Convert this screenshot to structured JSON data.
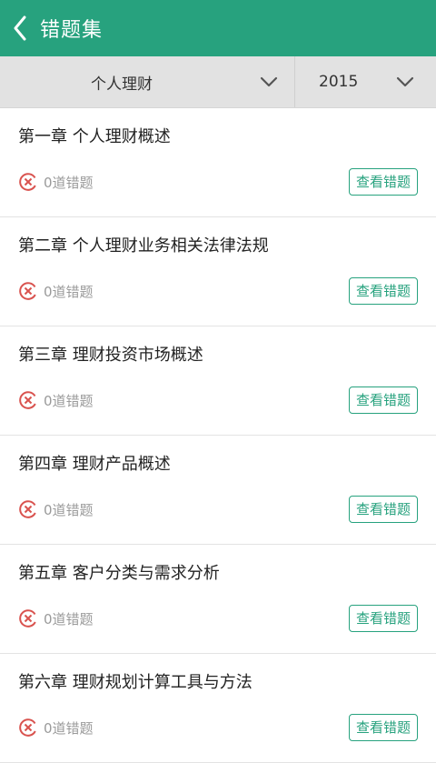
{
  "header": {
    "title": "错题集"
  },
  "filters": {
    "subject": "个人理财",
    "year": "2015"
  },
  "chapters": [
    {
      "title": "第一章 个人理财概述",
      "count": "0道错题",
      "button": "查看错题"
    },
    {
      "title": "第二章 个人理财业务相关法律法规",
      "count": "0道错题",
      "button": "查看错题"
    },
    {
      "title": "第三章 理财投资市场概述",
      "count": "0道错题",
      "button": "查看错题"
    },
    {
      "title": "第四章 理财产品概述",
      "count": "0道错题",
      "button": "查看错题"
    },
    {
      "title": "第五章 客户分类与需求分析",
      "count": "0道错题",
      "button": "查看错题"
    },
    {
      "title": "第六章 理财规划计算工具与方法",
      "count": "0道错题",
      "button": "查看错题"
    }
  ],
  "colors": {
    "primary": "#27a27e",
    "error": "#d9534f"
  },
  "icons": {
    "back": "chevron-left-icon",
    "dropdown": "chevron-down-icon",
    "wrong": "x-circle-icon"
  }
}
